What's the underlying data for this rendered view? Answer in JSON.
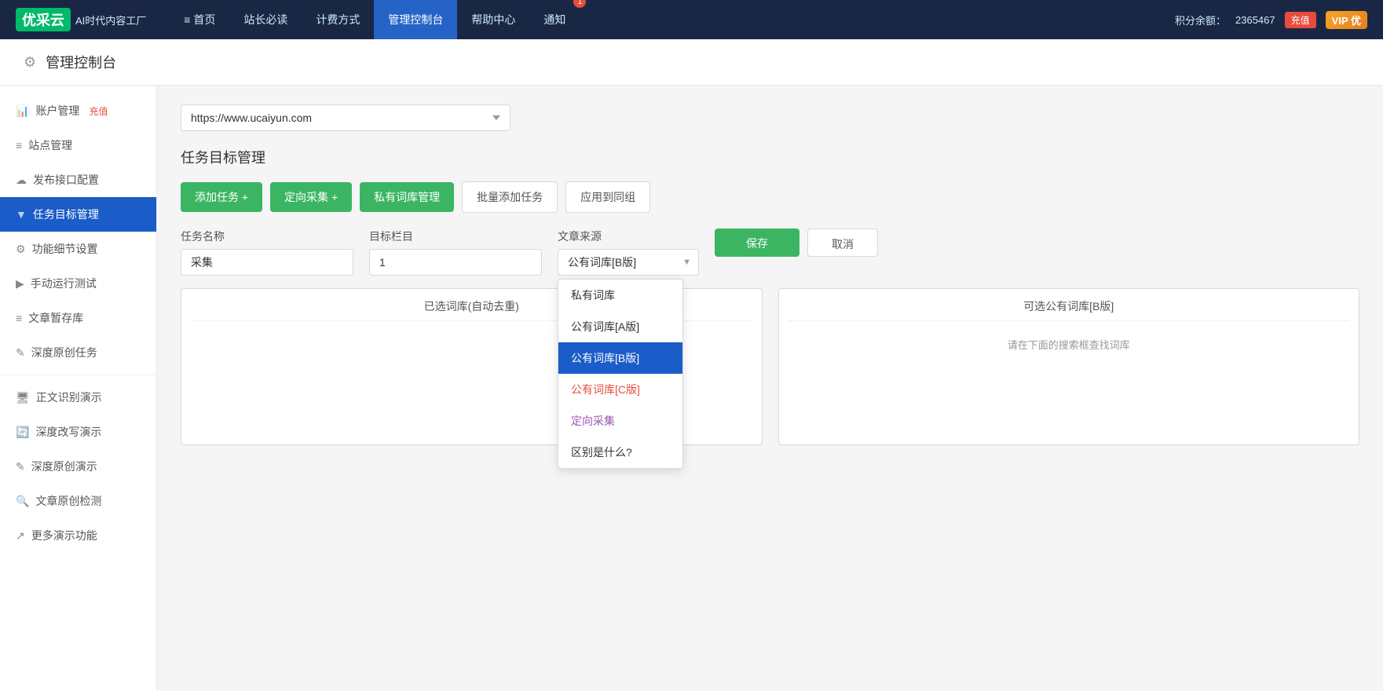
{
  "topnav": {
    "logo_text": "优采云",
    "logo_sub": "AI时代内容工厂",
    "items": [
      {
        "label": "≡ 首页",
        "active": false
      },
      {
        "label": "站长必读",
        "active": false
      },
      {
        "label": "计费方式",
        "active": false
      },
      {
        "label": "管理控制台",
        "active": true
      },
      {
        "label": "帮助中心",
        "active": false
      },
      {
        "label": "通知",
        "active": false
      }
    ],
    "notif_count": "1",
    "score_label": "积分余额：",
    "score_value": "2365467",
    "recharge_btn": "充值",
    "vip_label": "VIP 优"
  },
  "page_header": {
    "icon": "⚙",
    "title": "管理控制台"
  },
  "sidebar": {
    "items": [
      {
        "icon": "📊",
        "label": "账户管理",
        "recharge": "充值",
        "active": false
      },
      {
        "icon": "≡",
        "label": "站点管理",
        "active": false
      },
      {
        "icon": "☁",
        "label": "发布接口配置",
        "active": false
      },
      {
        "icon": "▼",
        "label": "任务目标管理",
        "active": true
      },
      {
        "icon": "⚙",
        "label": "功能细节设置",
        "active": false
      },
      {
        "icon": "▶",
        "label": "手动运行测试",
        "active": false
      },
      {
        "icon": "≡",
        "label": "文章暂存库",
        "active": false
      },
      {
        "icon": "✎",
        "label": "深度原创任务",
        "active": false
      },
      {
        "icon": "🖥",
        "label": "正文识别演示",
        "active": false
      },
      {
        "icon": "🔄",
        "label": "深度改写演示",
        "active": false
      },
      {
        "icon": "✎",
        "label": "深度原创演示",
        "active": false
      },
      {
        "icon": "🔍",
        "label": "文章原创检测",
        "active": false
      },
      {
        "icon": "↗",
        "label": "更多演示功能",
        "active": false
      }
    ]
  },
  "content": {
    "url_select_value": "https://www.ucaiyun.com",
    "section_title": "任务目标管理",
    "toolbar": {
      "add_task": "添加任务 +",
      "directed_collect": "定向采集 +",
      "private_lib": "私有词库管理",
      "batch_add": "批量添加任务",
      "apply_group": "应用到同组"
    },
    "form": {
      "task_name_label": "任务名称",
      "task_name_value": "采集",
      "target_col_label": "目标栏目",
      "target_col_value": "1",
      "source_label": "文章来源",
      "source_value": "公有词库[B版]",
      "save_btn": "保存",
      "cancel_btn": "取消"
    },
    "dropdown": {
      "options": [
        {
          "label": "私有词库",
          "type": "normal",
          "selected": false
        },
        {
          "label": "公有词库[A版]",
          "type": "normal",
          "selected": false
        },
        {
          "label": "公有词库[B版]",
          "type": "normal",
          "selected": true
        },
        {
          "label": "公有词库[C版]",
          "type": "c-version",
          "selected": false
        },
        {
          "label": "定向采集",
          "type": "directional",
          "selected": false
        },
        {
          "label": "区别是什么?",
          "type": "question",
          "selected": false
        }
      ]
    },
    "selected_lib_label": "已选词库(自动去重)",
    "available_lib_label": "可选公有词库[B版]",
    "available_lib_hint": "请在下面的搜索框查找词库"
  }
}
